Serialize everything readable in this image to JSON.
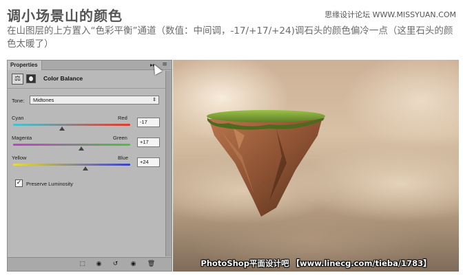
{
  "article": {
    "heading": "调小场景山的颜色",
    "site_tag": "思缘设计论坛 WWW.MISSYUAN.COM",
    "description": "在山图层的上方置入“色彩平衡”通道（数值：中间调，-17/+17/+24)调石头的颜色偏冷一点（这里石头的颜色太暖了）"
  },
  "panel": {
    "tab_label": "Properties",
    "collapse_symbol": "▸▸",
    "menu_symbol": "≡",
    "title": "Color Balance",
    "tone_label": "Tone:",
    "tone_value": "Midtones",
    "sliders": [
      {
        "left": "Cyan",
        "right": "Red",
        "value": "-17",
        "fraction": 0.415
      },
      {
        "left": "Magenta",
        "right": "Green",
        "value": "+17",
        "fraction": 0.585
      },
      {
        "left": "Yellow",
        "right": "Blue",
        "value": "+24",
        "fraction": 0.62
      }
    ],
    "preserve_label": "Preserve Luminosity",
    "preserve_checked": "✓",
    "bottom_buttons": [
      "⬚",
      "◉",
      "↺",
      "◉",
      "🗑"
    ]
  },
  "photo": {
    "watermark": "PhotoShop平面设计吧 【www.linecg.com/tieba/1783】"
  },
  "colors": {
    "cyan_red_left": "#3ec6d6",
    "cyan_red_right": "#e23a2c",
    "magenta_green_left": "#c43ccf",
    "magenta_green_right": "#4cc143",
    "yellow_blue_left": "#e8dc3a",
    "yellow_blue_right": "#3a3fd0"
  }
}
